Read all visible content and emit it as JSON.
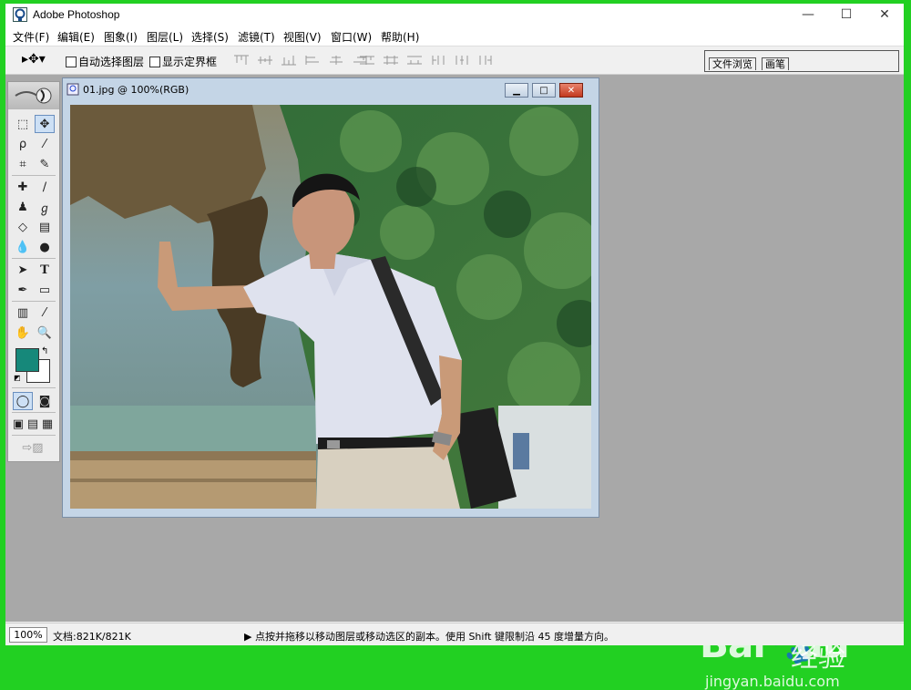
{
  "app": {
    "title": "Adobe Photoshop"
  },
  "window_controls": {
    "minimize": "—",
    "maximize": "☐",
    "close": "✕"
  },
  "menu": [
    "文件(F)",
    "编辑(E)",
    "图象(I)",
    "图层(L)",
    "选择(S)",
    "滤镜(T)",
    "视图(V)",
    "窗口(W)",
    "帮助(H)"
  ],
  "options": {
    "auto_select_layer": "自动选择图层",
    "show_bounding_box": "显示定界框",
    "tabs": [
      "文件浏览",
      "画笔"
    ]
  },
  "document": {
    "title": "01.jpg @ 100%(RGB)",
    "controls": {
      "min": "▁",
      "max": "□",
      "close": "✕"
    }
  },
  "colors": {
    "foreground": "#16887a",
    "background": "#ffffff"
  },
  "tools": [
    "marquee-icon",
    "move-icon",
    "lasso-icon",
    "magic-wand-icon",
    "crop-icon",
    "slice-icon",
    "healing-brush-icon",
    "brush-icon",
    "clone-stamp-icon",
    "history-brush-icon",
    "eraser-icon",
    "gradient-icon",
    "blur-icon",
    "dodge-icon",
    "path-select-icon",
    "type-icon",
    "pen-icon",
    "shape-icon",
    "notes-icon",
    "eyedropper-icon",
    "hand-icon",
    "zoom-icon"
  ],
  "status": {
    "zoom": "100%",
    "doc": "文档:821K/821K",
    "hint": "▶ 点按并拖移以移动图层或移动选区的副本。使用 Shift 键限制沿 45 度增量方向。"
  },
  "watermark": {
    "brand": "Bai",
    "brand2": "du",
    "suffix": "经验",
    "url": "jingyan.baidu.com"
  }
}
